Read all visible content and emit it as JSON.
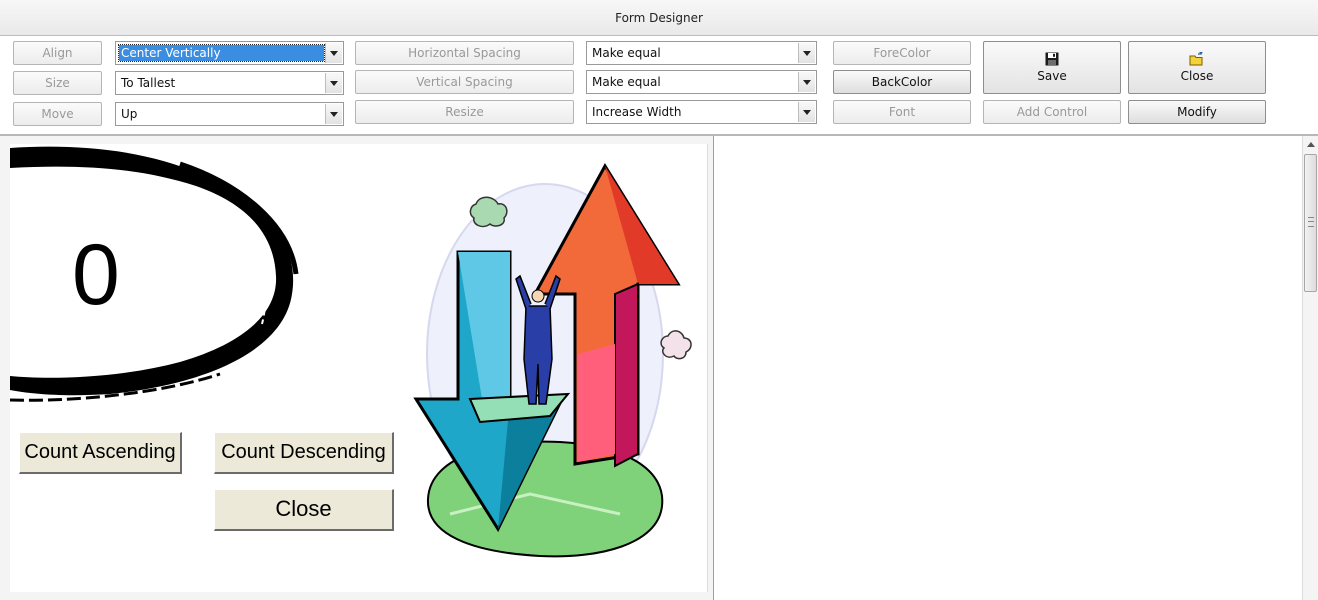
{
  "window": {
    "title": "Form Designer"
  },
  "toolbar": {
    "align_label": "Align",
    "size_label": "Size",
    "move_label": "Move",
    "align_value": "Center Vertically",
    "size_value": "To Tallest",
    "move_value": "Up",
    "horizontal_spacing_label": "Horizontal Spacing",
    "vertical_spacing_label": "Vertical Spacing",
    "resize_label": "Resize",
    "horizontal_spacing_value": "Make equal",
    "vertical_spacing_value": "Make equal",
    "resize_value": "Increase Width",
    "forecolor_label": "ForeColor",
    "backcolor_label": "BackColor",
    "font_label": "Font",
    "save_label": "Save",
    "close_label": "Close",
    "add_control_label": "Add Control",
    "modify_label": "Modify",
    "save_icon": "floppy-disk-icon",
    "close_icon": "open-folder-icon"
  },
  "form": {
    "counter_value": "0",
    "count_ascending_label": "Count Ascending",
    "count_descending_label": "Count Descending",
    "close_label": "Close",
    "button_face_color": "#ece9d8",
    "clipart": "businessman-on-arrows-clipart",
    "brush_stroke": "black-ink-brush-stroke"
  },
  "colors": {
    "selection": "#3a8de0",
    "disabled_text": "#999999"
  }
}
